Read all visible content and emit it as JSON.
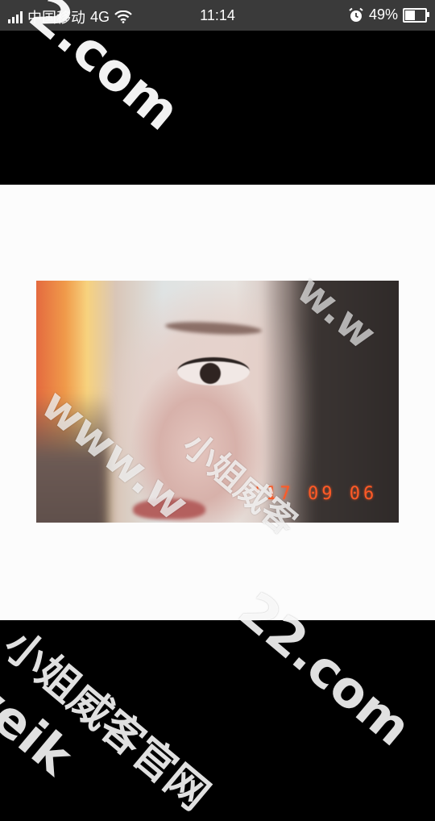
{
  "status_bar": {
    "carrier": "中国移动",
    "network": "4G",
    "time": "11:14",
    "battery_percent": "49%",
    "battery_level": 0.49,
    "icons": [
      "signal-icon",
      "wifi-icon",
      "alarm-icon",
      "battery-icon"
    ]
  },
  "photo": {
    "date_stamp": "'17 09 06"
  },
  "watermarks": {
    "top_domain": "2.com",
    "photo_diag": "www.w",
    "photo_cn": "小姐威客",
    "photo_right": "w.w",
    "bottom_cn": "小姐威客官网",
    "bottom_domain": "22.com",
    "bottom_latin": "weik"
  },
  "colors": {
    "status_bar_bg": "#3a3a3a",
    "viewer_bg": "#000000",
    "card_bg": "#fcfcfc",
    "date_stamp": "#ff5a26"
  }
}
